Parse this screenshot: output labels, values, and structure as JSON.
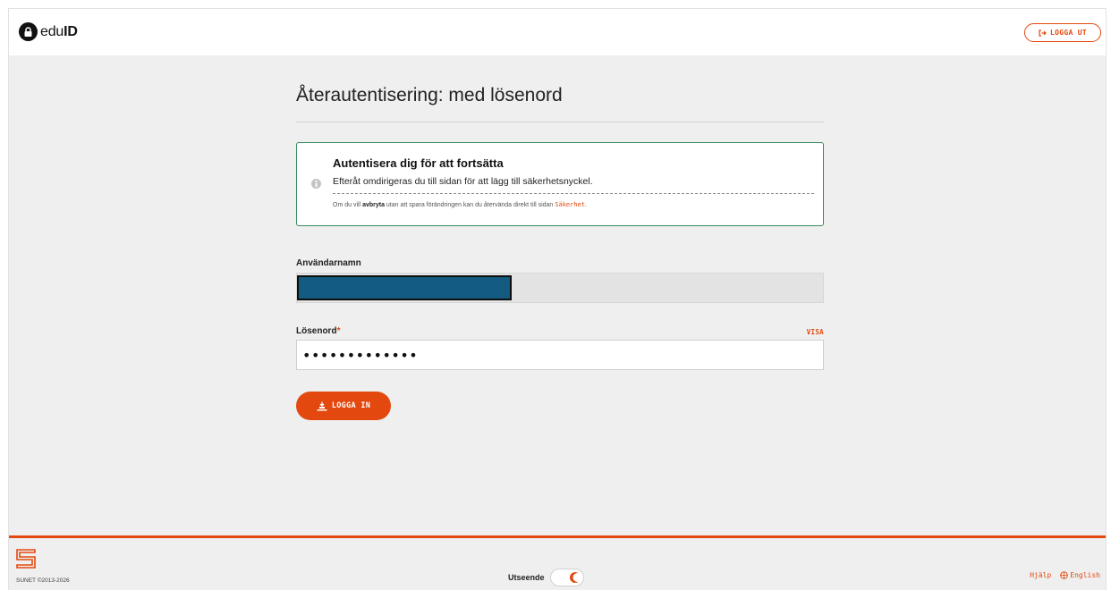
{
  "header": {
    "logo_edu": "edu",
    "logo_id": "ID",
    "logout_label": "LOGGA UT"
  },
  "main": {
    "title": "Återautentisering: med lösenord",
    "alert": {
      "title": "Autentisera dig för att fortsätta",
      "text": "Efteråt omdirigeras du till sidan för att lägg till säkerhetsnyckel.",
      "note_prefix": "Om du vill ",
      "note_bold": "avbryta",
      "note_middle": " utan att spara förändringen kan du återvända direkt till sidan ",
      "note_link": "Säkerhet",
      "note_suffix": "."
    },
    "username_label": "Användarnamn",
    "password_label": "Lösenord",
    "password_required_mark": "*",
    "show_label": "VISA",
    "password_value": "•••••••••••••",
    "login_label": "LOGGA IN"
  },
  "footer": {
    "sunet_label": "SUNET",
    "copyright": "©2013-2026",
    "appearance_label": "Utseende",
    "help_label": "Hjälp",
    "language_label": "English"
  },
  "colors": {
    "accent": "#e3480f",
    "alert_border": "#3d8b5c",
    "redaction": "#135b80"
  }
}
